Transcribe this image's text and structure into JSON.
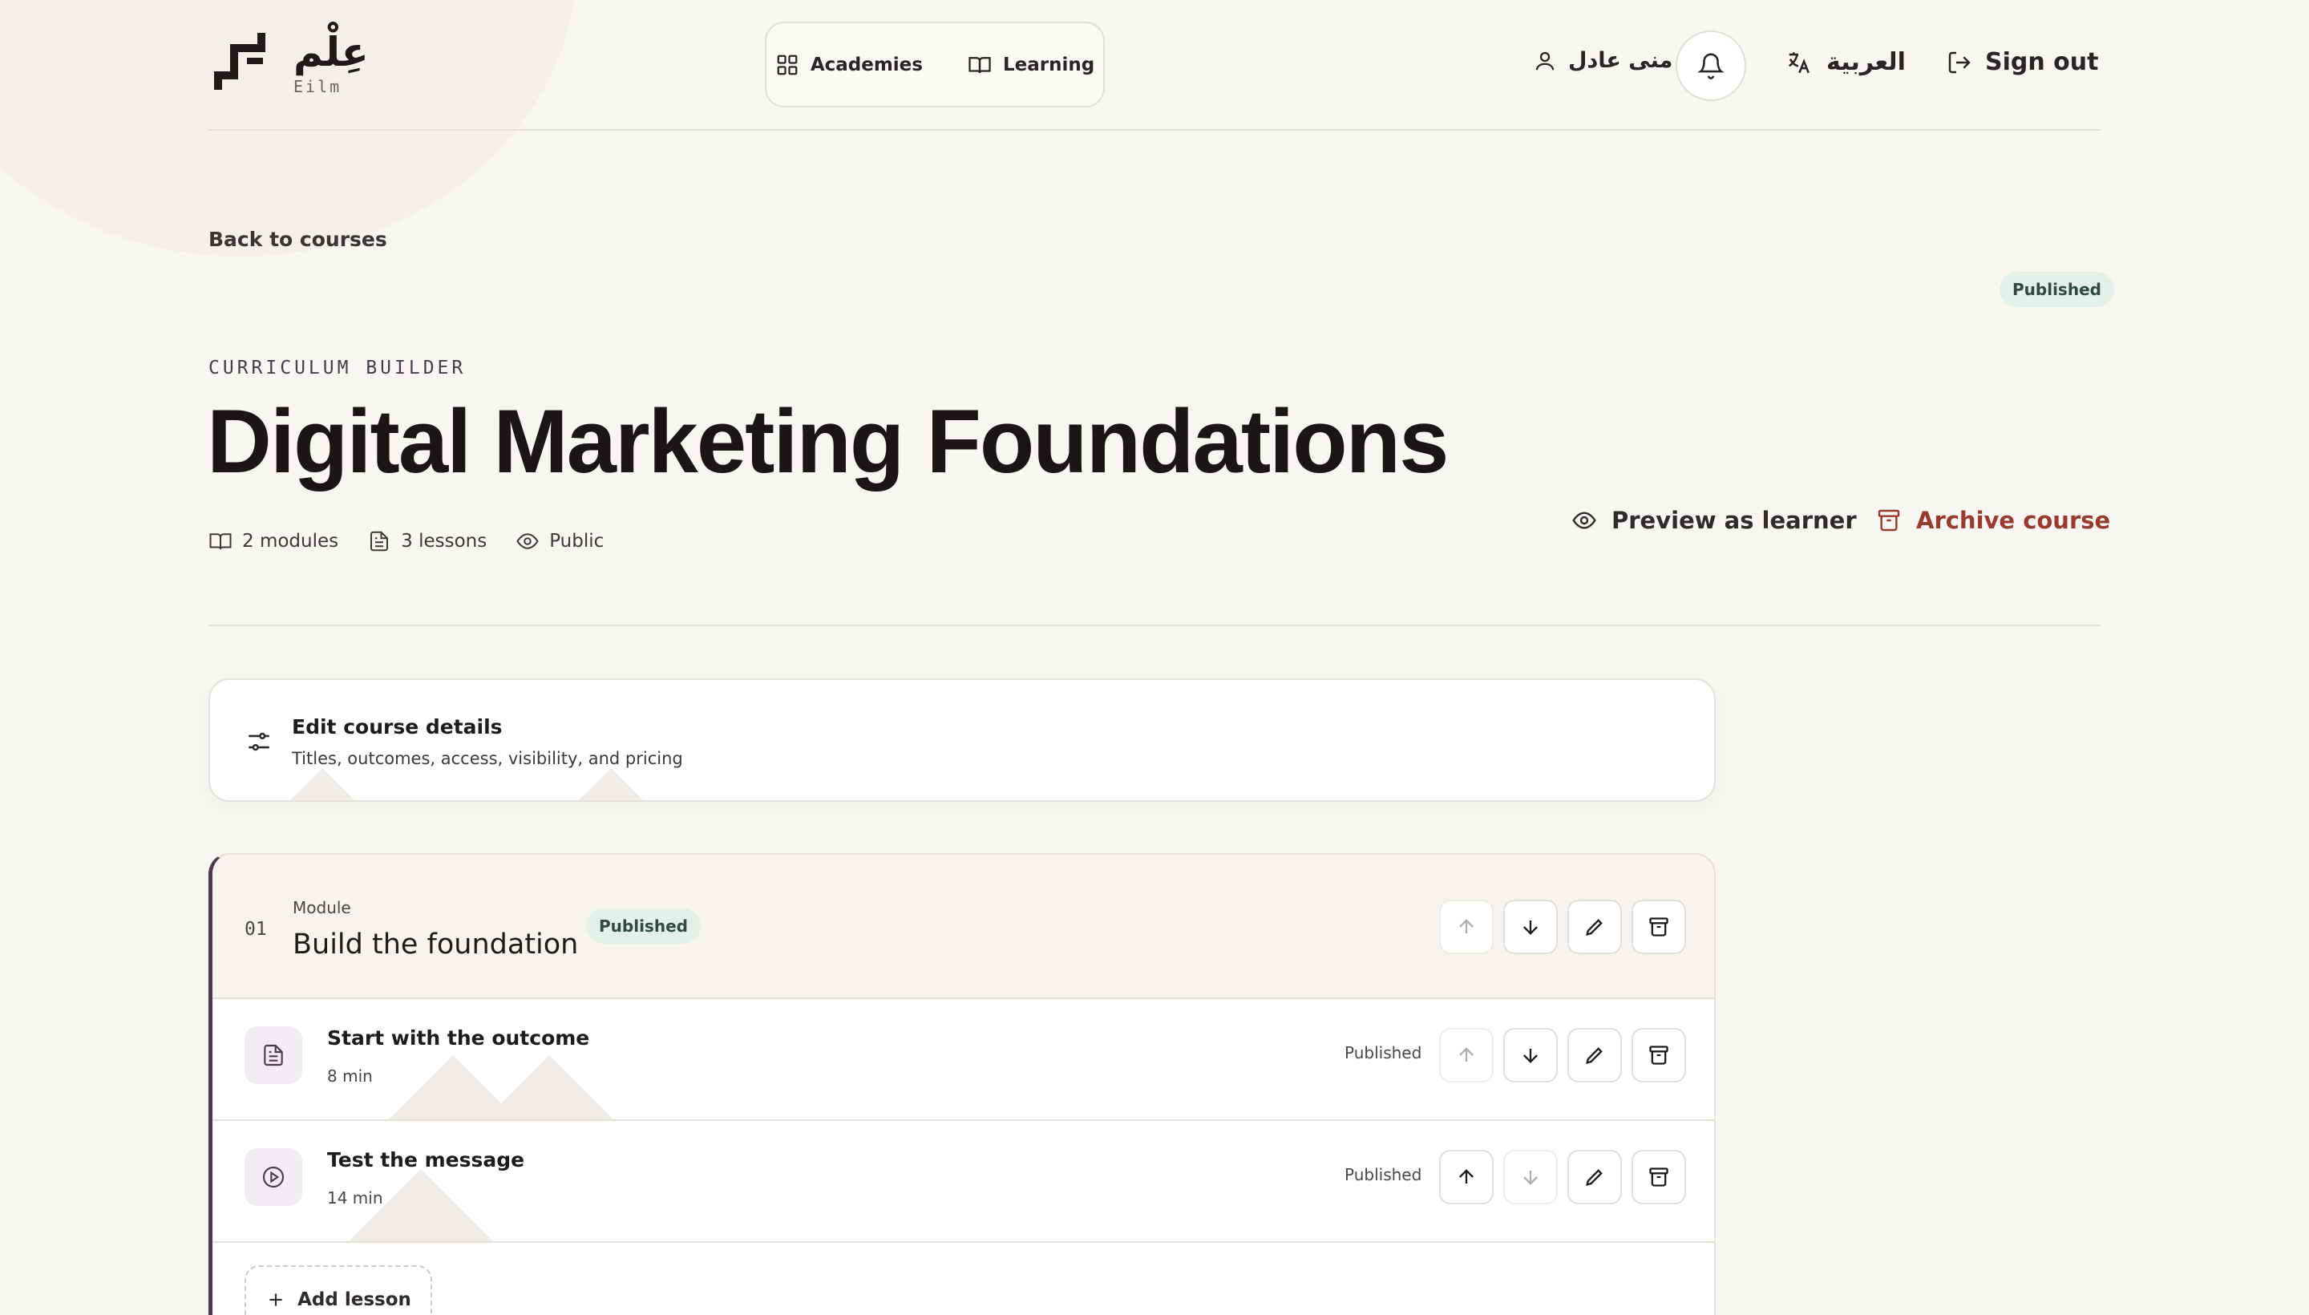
{
  "brand": {
    "arabic": "عِلْم",
    "latin": "Eilm"
  },
  "nav": {
    "academies": "Academies",
    "learning": "Learning"
  },
  "user": {
    "name": "منى عادل"
  },
  "language": {
    "label": "العربية"
  },
  "auth": {
    "sign_out": "Sign out"
  },
  "back_link": "Back to courses",
  "course": {
    "status": "Published",
    "eyebrow": "CURRICULUM BUILDER",
    "title": "Digital Marketing Foundations",
    "meta": {
      "modules": "2 modules",
      "lessons": "3 lessons",
      "visibility": "Public"
    },
    "actions": {
      "preview": "Preview as learner",
      "archive": "Archive course"
    }
  },
  "edit_details": {
    "title": "Edit course details",
    "subtitle": "Titles, outcomes, access, visibility, and pricing"
  },
  "module": {
    "number": "01",
    "label": "Module",
    "title": "Build the foundation",
    "status": "Published",
    "lessons": [
      {
        "title": "Start with the outcome",
        "duration": "8 min",
        "status": "Published",
        "icon": "document-icon"
      },
      {
        "title": "Test the message",
        "duration": "14 min",
        "status": "Published",
        "icon": "play-icon"
      }
    ],
    "add_lesson": "Add lesson"
  },
  "colors": {
    "accent": "#4d3a50",
    "danger": "#9a3a2a",
    "badge_bg": "#e3efe9",
    "badge_fg": "#2f4a40"
  }
}
